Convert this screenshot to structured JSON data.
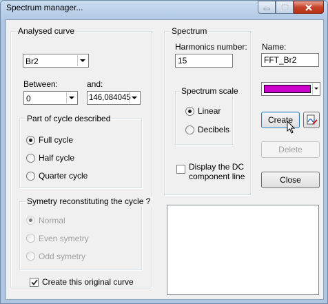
{
  "window": {
    "title": "Spectrum manager..."
  },
  "analysed": {
    "group_label": "Analysed curve",
    "curve_value": "Br2",
    "between_label": "Between:",
    "between_value": "0",
    "and_label": "and:",
    "and_value": "146,084045"
  },
  "part_of_cycle": {
    "group_label": "Part of cycle described",
    "options": [
      "Full cycle",
      "Half cycle",
      "Quarter cycle"
    ],
    "selected": "Full cycle"
  },
  "symetry": {
    "group_label": "Symetry reconstituting the cycle ?",
    "options": [
      "Normal",
      "Even symetry",
      "Odd symetry"
    ],
    "selected": "Normal"
  },
  "create_original": {
    "label": "Create this original curve",
    "checked": true
  },
  "spectrum": {
    "group_label": "Spectrum",
    "harmonics_label": "Harmonics number:",
    "harmonics_value": "15",
    "scale_group_label": "Spectrum scale",
    "scale_options": [
      "Linear",
      "Decibels"
    ],
    "scale_selected": "Linear",
    "dc_line_label_1": "Display the DC",
    "dc_line_label_2": "component line",
    "dc_line_checked": false
  },
  "right": {
    "name_label": "Name:",
    "name_value": "FFT_Br2",
    "color": "#cc00cc",
    "create_label": "Create",
    "delete_label": "Delete",
    "close_label": "Close"
  },
  "colors": {
    "accent_magenta": "#cc00cc",
    "title_close_red": "#c7432b"
  }
}
